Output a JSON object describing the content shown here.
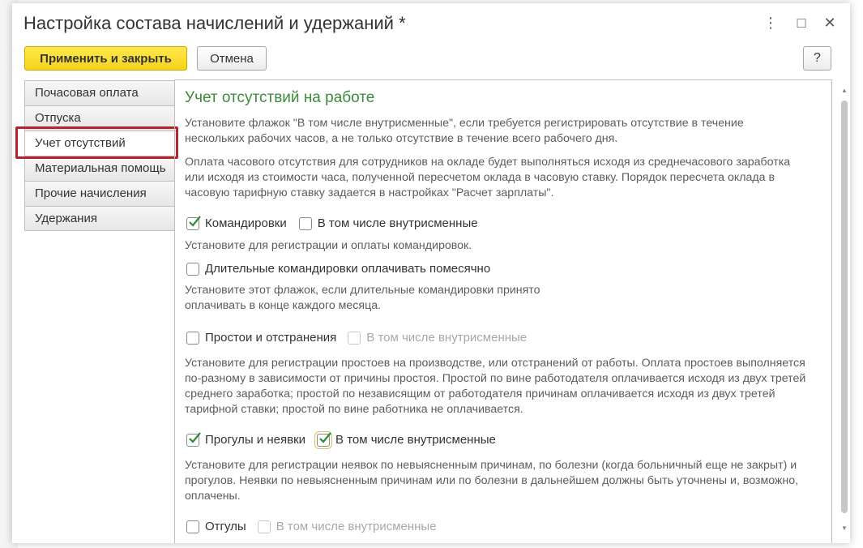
{
  "window": {
    "title": "Настройка состава начислений и удержаний *",
    "controls": {
      "menu": "⋮",
      "maximize": "□",
      "close": "✕"
    }
  },
  "toolbar": {
    "apply_close": "Применить и закрыть",
    "cancel": "Отмена",
    "help": "?"
  },
  "tabs": [
    {
      "label": "Почасовая оплата"
    },
    {
      "label": "Отпуска"
    },
    {
      "label": "Учет отсутствий",
      "active": true
    },
    {
      "label": "Материальная помощь"
    },
    {
      "label": "Прочие начисления"
    },
    {
      "label": "Удержания"
    }
  ],
  "content": {
    "heading": "Учет отсутствий на работе",
    "intro1": "Установите флажок \"В том числе внутрисменные\", если требуется регистрировать отсутствие в течение нескольких рабочих часов, а не только отсутствие в течение всего рабочего дня.",
    "intro2": "Оплата часового отсутствия для сотрудников на окладе будет выполняться исходя из среднечасового заработка или исходя из стоимости часа, полученной пересчетом оклада в часовую ставку. Порядок пересчета оклада в часовую тарифную ставку задается в настройках \"Расчет зарплаты\".",
    "komandirovki": {
      "label": "Командировки",
      "checked": true,
      "intrashift_label": "В том числе внутрисменные",
      "intrashift_checked": false,
      "desc": "Установите для регистрации и оплаты командировок."
    },
    "long_trips": {
      "label": "Длительные командировки оплачивать помесячно",
      "checked": false,
      "desc": "Установите этот флажок, если длительные командировки принято оплачивать в конце каждого месяца."
    },
    "prostoi": {
      "label": "Простои и отстранения",
      "checked": false,
      "intrashift_label": "В том числе внутрисменные",
      "intrashift_disabled": true,
      "desc": "Установите для регистрации простоев на производстве, или отстранений от работы. Оплата простоев выполняется по-разному в зависимости от причины простоя. Простой по вине работодателя оплачивается исходя из двух третей среднего заработка; простой по независящим от работодателя причинам оплачивается исходя из двух третей тарифной ставки; простой по вине работника не оплачивается."
    },
    "progul": {
      "label": "Прогулы и неявки",
      "checked": true,
      "intrashift_label": "В том числе внутрисменные",
      "intrashift_checked": true,
      "desc": "Установите для регистрации неявок по невыясненным причинам, по болезни (когда больничный еще не закрыт) и прогулов. Неявки по невыясненным причинам или по болезни в дальнейшем должны быть уточнены и, возможно, оплачены."
    },
    "otguly": {
      "label": "Отгулы",
      "checked": false,
      "intrashift_label": "В том числе внутрисменные",
      "intrashift_disabled": true
    }
  },
  "colors": {
    "heading": "#3a8c3a",
    "check": "#2e8b3a",
    "primary_button": "#f7d21a",
    "highlight_frame": "#b3252e"
  }
}
